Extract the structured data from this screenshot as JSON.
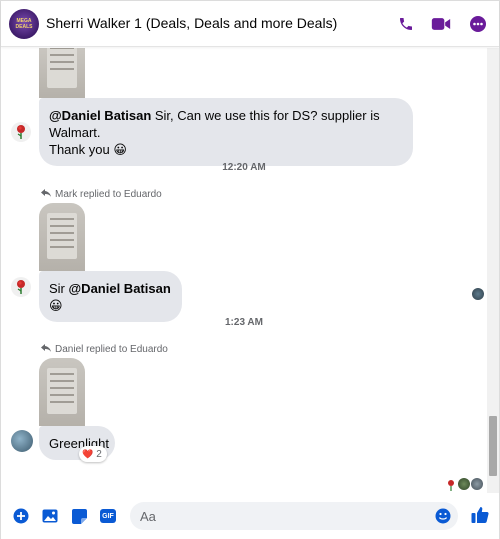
{
  "colors": {
    "accent": "#6a1b9a",
    "messenger_blue": "#0a5ad4",
    "bubble": "#e4e6eb",
    "meta": "#65676b"
  },
  "header": {
    "title": "Sherri Walker 1 (Deals, Deals and more Deals)",
    "icons": [
      "phone-icon",
      "video-camera-icon",
      "more-options-icon"
    ]
  },
  "messages": [
    {
      "type": "image",
      "sender_avatar": "rose-avatar"
    },
    {
      "type": "text",
      "mention": "@Daniel Batisan",
      "text_line1": " Sir, Can we use this for DS? supplier is Walmart.",
      "text_line2": "Thank you",
      "emoji": "😀"
    },
    {
      "type": "timestamp",
      "text": "12:20 AM"
    },
    {
      "type": "reply_header",
      "text": "Mark replied to Eduardo"
    },
    {
      "type": "image"
    },
    {
      "type": "text",
      "prefix": "Sir ",
      "mention": "@Daniel Batisan",
      "emoji": "😀"
    },
    {
      "type": "timestamp",
      "text": "1:23 AM"
    },
    {
      "type": "reply_header",
      "text": "Daniel replied to Eduardo"
    },
    {
      "type": "image"
    },
    {
      "type": "text",
      "text": "Greenlight",
      "reaction": {
        "emoji": "❤️",
        "count": "2"
      }
    }
  ],
  "composer": {
    "placeholder": "Aa",
    "icons": [
      "add-icon",
      "photo-icon",
      "sticker-icon",
      "gif-icon",
      "emoji-icon",
      "like-icon"
    ],
    "gif_label": "GIF"
  }
}
